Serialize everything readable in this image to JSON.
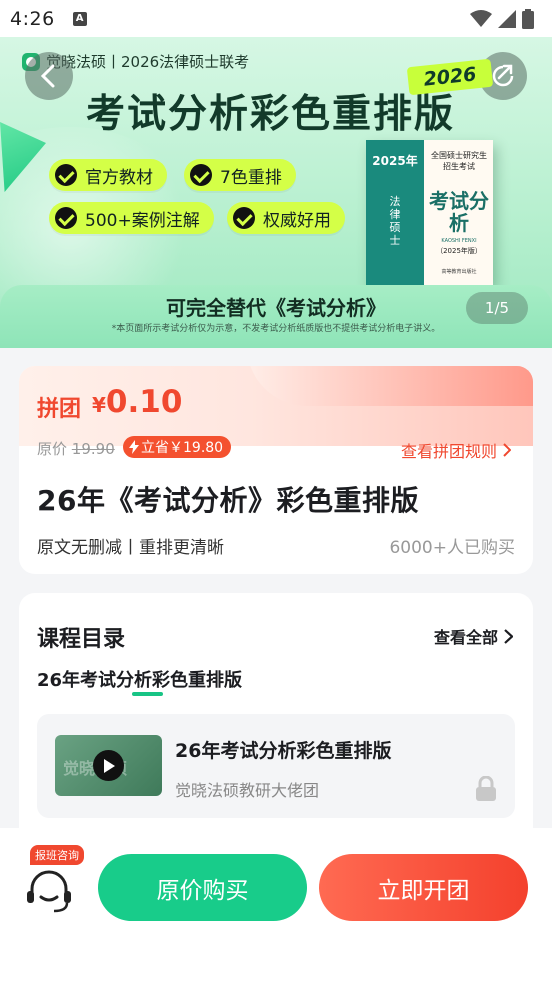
{
  "status_bar": {
    "time": "4:26"
  },
  "banner": {
    "brand": "觉晓法硕丨2026法律硕士联考",
    "headline": "考试分析彩色重排版",
    "year_badge": "2026",
    "tags": [
      "官方教材",
      "7色重排",
      "500+案例注解",
      "权威好用"
    ],
    "book": {
      "spine_year": "2025年",
      "spine_text": "法律硕士",
      "cover_top": "全国硕士研究生招生考试",
      "cover_title": "考试分析",
      "cover_pinyin": "KAOSHI FENXI",
      "cover_edition": "（2025年版）",
      "cover_publisher": "高等教育出版社"
    },
    "footer_title": "可完全替代《考试分析》",
    "footer_note": "*本页面所示考试分析仅为示意，不发考试分析纸质版也不提供考试分析电子讲义。",
    "pager": "1/5"
  },
  "price_card": {
    "label": "拼团",
    "currency": "¥",
    "price": "0.10",
    "orig_label": "原价",
    "orig_price": "19.90",
    "save_label": "立省￥19.80",
    "rules_link": "查看拼团规则",
    "title": "26年《考试分析》彩色重排版",
    "subtitle": "原文无删减丨重排更清晰",
    "sold": "6000+人已购买",
    "accent": "#f0482f"
  },
  "catalog": {
    "heading": "课程目录",
    "view_all": "查看全部",
    "active_tab": "26年考试分析彩色重排版",
    "lesson": {
      "title": "26年考试分析彩色重排版",
      "author": "觉晓法硕教研大佬团",
      "thumb_watermark": "觉晓法硕"
    }
  },
  "bottom_bar": {
    "consult_badge": "报班咨询",
    "buy_original": "原价购买",
    "start_group": "立即开团",
    "primary_green": "#18cc8a",
    "primary_red": "#f4412d"
  }
}
